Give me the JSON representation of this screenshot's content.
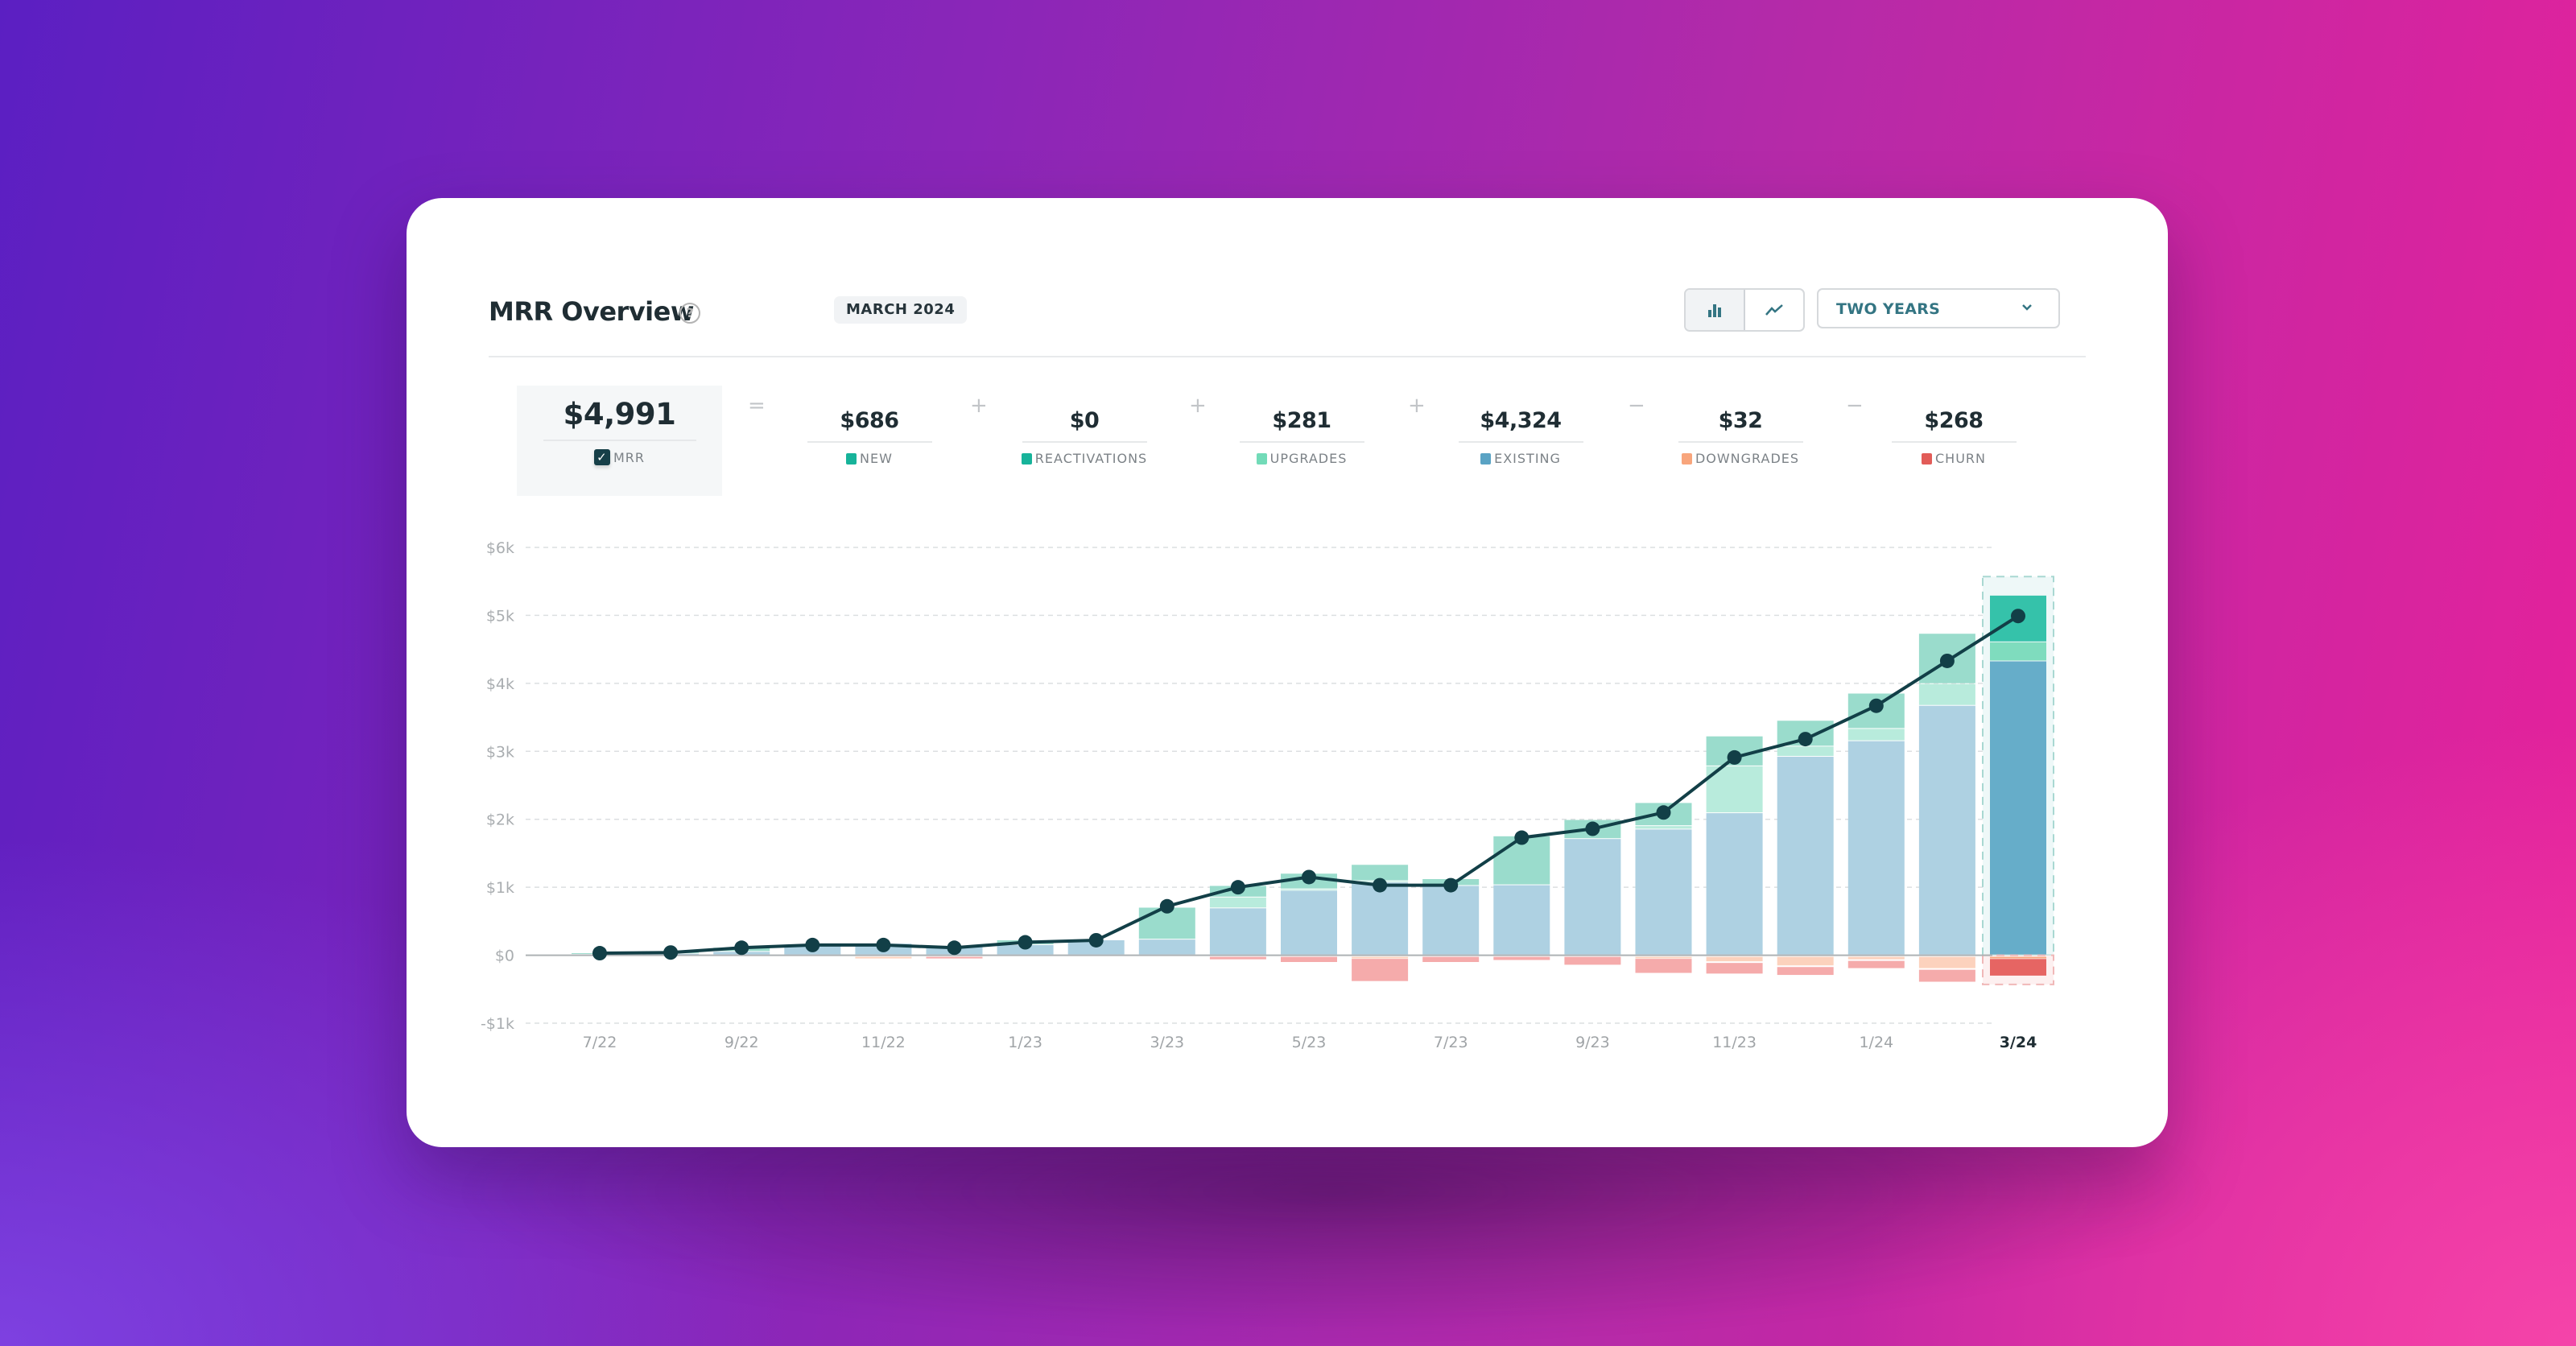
{
  "header": {
    "title": "MRR Overview",
    "help_icon": "question-circle-icon",
    "date_badge": "MARCH 2024",
    "view_toggle": [
      {
        "name": "bar-chart",
        "icon": "bar-chart-icon",
        "active": true
      },
      {
        "name": "line-chart",
        "icon": "line-chart-icon",
        "active": false
      }
    ],
    "range_select": {
      "value": "TWO YEARS",
      "icon": "chevron-down-icon"
    }
  },
  "summary": {
    "mrr": {
      "value": "$4,991",
      "label": "MRR",
      "checked": true
    },
    "operators": [
      "=",
      "+",
      "+",
      "+",
      "−",
      "−"
    ],
    "metrics": [
      {
        "value": "$686",
        "label": "NEW",
        "color": "#17b39a"
      },
      {
        "value": "$0",
        "label": "REACTIVATIONS",
        "color": "#17b39a"
      },
      {
        "value": "$281",
        "label": "UPGRADES",
        "color": "#72dbb8"
      },
      {
        "value": "$4,324",
        "label": "EXISTING",
        "color": "#5aa3c4"
      },
      {
        "value": "$32",
        "label": "DOWNGRADES",
        "color": "#f8a57c"
      },
      {
        "value": "$268",
        "label": "CHURN",
        "color": "#e25c58"
      }
    ]
  },
  "chart_data": {
    "type": "bar",
    "stacked": true,
    "title": "MRR Overview",
    "xlabel": "",
    "ylabel": "",
    "ylim": [
      -1000,
      6000
    ],
    "yticks": [
      6000,
      5000,
      4000,
      3000,
      2000,
      1000,
      0,
      -1000
    ],
    "ytick_labels": [
      "$6k",
      "$5k",
      "$4k",
      "$3k",
      "$2k",
      "$1k",
      "$0",
      "-$1k"
    ],
    "grid": true,
    "categories": [
      "7/22",
      "8/22",
      "9/22",
      "10/22",
      "11/22",
      "12/22",
      "1/23",
      "2/23",
      "3/23",
      "4/23",
      "5/23",
      "6/23",
      "7/23",
      "8/23",
      "9/23",
      "10/23",
      "11/23",
      "12/23",
      "1/24",
      "2/24",
      "3/24"
    ],
    "xtick_labels": [
      "7/22",
      "",
      "9/22",
      "",
      "11/22",
      "",
      "1/23",
      "",
      "3/23",
      "",
      "5/23",
      "",
      "7/23",
      "",
      "9/23",
      "",
      "11/23",
      "",
      "1/24",
      "",
      "3/24"
    ],
    "highlighted_category": "3/24",
    "series": [
      {
        "name": "Existing",
        "color": "#aed1e2",
        "highlight_color": "#66adc9",
        "values": [
          10,
          20,
          50,
          150,
          170,
          120,
          150,
          220,
          230,
          690,
          950,
          1070,
          1020,
          1030,
          1710,
          1850,
          2090,
          2920,
          3150,
          3670,
          4324
        ]
      },
      {
        "name": "Upgrades",
        "color": "#b8ebdc",
        "highlight_color": "#7fdcbe",
        "values": [
          0,
          0,
          0,
          0,
          0,
          0,
          0,
          0,
          0,
          160,
          20,
          20,
          0,
          0,
          0,
          50,
          690,
          150,
          180,
          320,
          281
        ]
      },
      {
        "name": "Reactivations",
        "color": "#9adccc",
        "highlight_color": "#2fbfa5",
        "values": [
          0,
          0,
          0,
          0,
          0,
          0,
          0,
          0,
          0,
          0,
          0,
          0,
          0,
          0,
          0,
          0,
          0,
          0,
          0,
          0,
          0
        ]
      },
      {
        "name": "New",
        "color": "#9adccc",
        "highlight_color": "#35c2aa",
        "values": [
          20,
          20,
          60,
          0,
          0,
          0,
          70,
          0,
          470,
          170,
          230,
          240,
          100,
          720,
          280,
          340,
          440,
          380,
          520,
          740,
          686
        ]
      },
      {
        "name": "Downgrades",
        "color": "#fcd2bd",
        "highlight_color": "#f8a57c",
        "values": [
          0,
          0,
          0,
          0,
          -40,
          0,
          0,
          0,
          0,
          0,
          0,
          -30,
          0,
          0,
          0,
          -30,
          -90,
          -150,
          -60,
          -190,
          -32
        ]
      },
      {
        "name": "Churn",
        "color": "#f5abab",
        "highlight_color": "#e66563",
        "values": [
          0,
          0,
          0,
          0,
          0,
          -30,
          0,
          0,
          0,
          -60,
          -100,
          -350,
          -100,
          -70,
          -140,
          -230,
          -180,
          -140,
          -130,
          -200,
          -268
        ]
      }
    ],
    "line": {
      "name": "MRR",
      "color": "#123f47",
      "values": [
        30,
        40,
        110,
        150,
        150,
        110,
        190,
        220,
        720,
        1000,
        1150,
        1030,
        1030,
        1730,
        1860,
        2100,
        2910,
        3180,
        3670,
        4330,
        4991
      ]
    }
  }
}
